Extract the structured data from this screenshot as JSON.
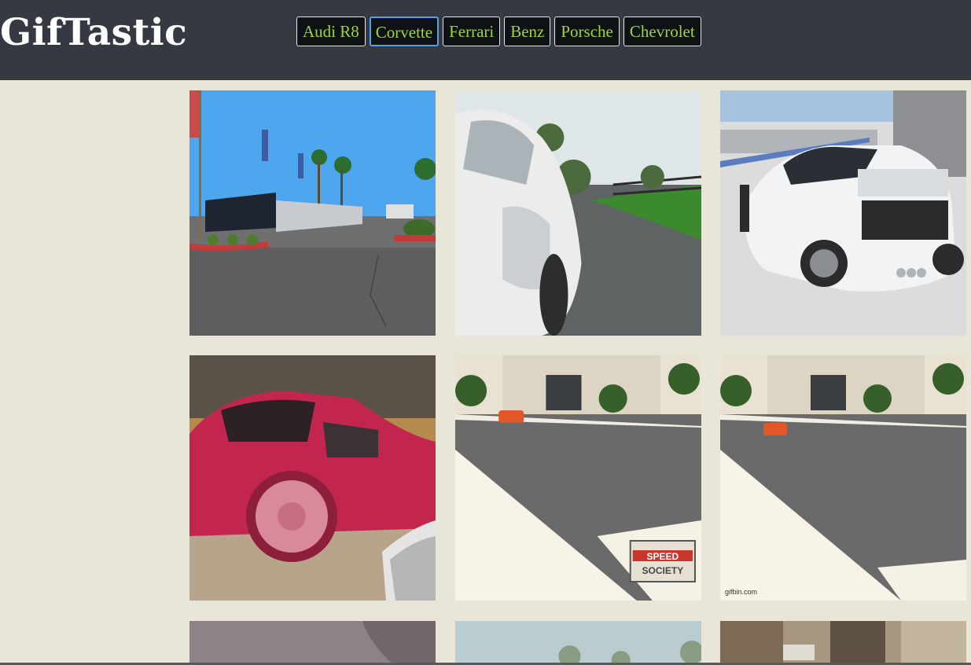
{
  "header": {
    "title": "GifTastic"
  },
  "buttons": [
    {
      "label": "Audi R8",
      "focused": false
    },
    {
      "label": "Corvette",
      "focused": true
    },
    {
      "label": "Ferrari",
      "focused": false
    },
    {
      "label": "Benz",
      "focused": false
    },
    {
      "label": "Porsche",
      "focused": false
    },
    {
      "label": "Chevrolet",
      "focused": false
    }
  ],
  "gifs": [
    {
      "scene": "dealership-lot",
      "watermark": ""
    },
    {
      "scene": "white-car-motion",
      "watermark": ""
    },
    {
      "scene": "white-corvette-track",
      "watermark": ""
    },
    {
      "scene": "red-corvette",
      "watermark": ""
    },
    {
      "scene": "rc-car-driveway",
      "watermark": "SPEED SOCIETY"
    },
    {
      "scene": "rc-car-driveway",
      "watermark": "gifbin.com"
    },
    {
      "scene": "mauve-blur",
      "watermark": ""
    },
    {
      "scene": "sky-trees",
      "watermark": ""
    },
    {
      "scene": "city-street",
      "watermark": ""
    }
  ]
}
